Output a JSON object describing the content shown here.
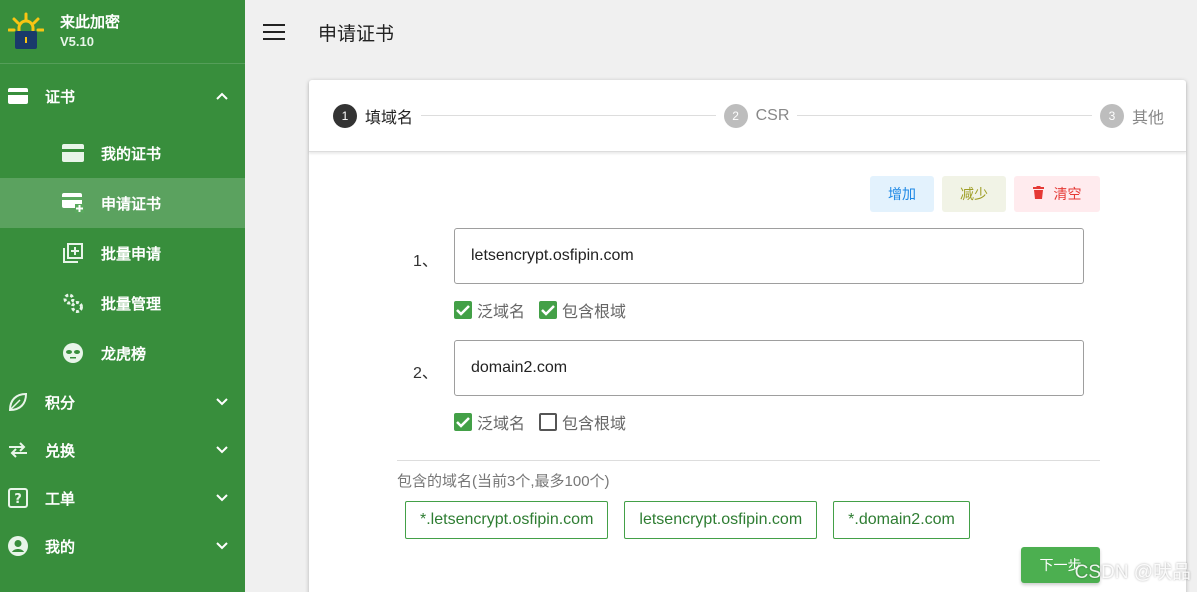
{
  "brand": {
    "title": "来此加密",
    "version": "V5.10"
  },
  "sidebar": {
    "cert_group": {
      "label": "证书",
      "icon": "card-icon"
    },
    "sub_items": [
      {
        "label": "我的证书",
        "icon": "credit-card-icon"
      },
      {
        "label": "申请证书",
        "icon": "card-add-icon",
        "active": true
      },
      {
        "label": "批量申请",
        "icon": "library-add-icon"
      },
      {
        "label": "批量管理",
        "icon": "gears-icon"
      },
      {
        "label": "龙虎榜",
        "icon": "alien-icon"
      }
    ],
    "groups": [
      {
        "label": "积分",
        "icon": "leaf-icon"
      },
      {
        "label": "兑换",
        "icon": "swap-icon"
      },
      {
        "label": "工单",
        "icon": "help-box-icon"
      },
      {
        "label": "我的",
        "icon": "account-circle-icon"
      }
    ]
  },
  "topbar": {
    "title": "申请证书"
  },
  "stepper": [
    {
      "num": "1",
      "label": "填域名"
    },
    {
      "num": "2",
      "label": "CSR"
    },
    {
      "num": "3",
      "label": "其他"
    }
  ],
  "actions": {
    "add": "增加",
    "remove": "减少",
    "clear": "清空"
  },
  "domains": [
    {
      "index": "1、",
      "value": "letsencrypt.osfipin.com",
      "wildcard_label": "泛域名",
      "root_label": "包含根域",
      "wildcard": true,
      "root": true
    },
    {
      "index": "2、",
      "value": "domain2.com",
      "wildcard_label": "泛域名",
      "root_label": "包含根域",
      "wildcard": true,
      "root": false
    }
  ],
  "included": {
    "label": "包含的域名(当前3个,最多100个)",
    "chips": [
      "*.letsencrypt.osfipin.com",
      "letsencrypt.osfipin.com",
      "*.domain2.com"
    ]
  },
  "next_button": "下一步",
  "watermark": "CSDN @吠品",
  "colors": {
    "sidebar": "#388e3c",
    "primary": "#4caf50",
    "checked": "#43a047"
  }
}
